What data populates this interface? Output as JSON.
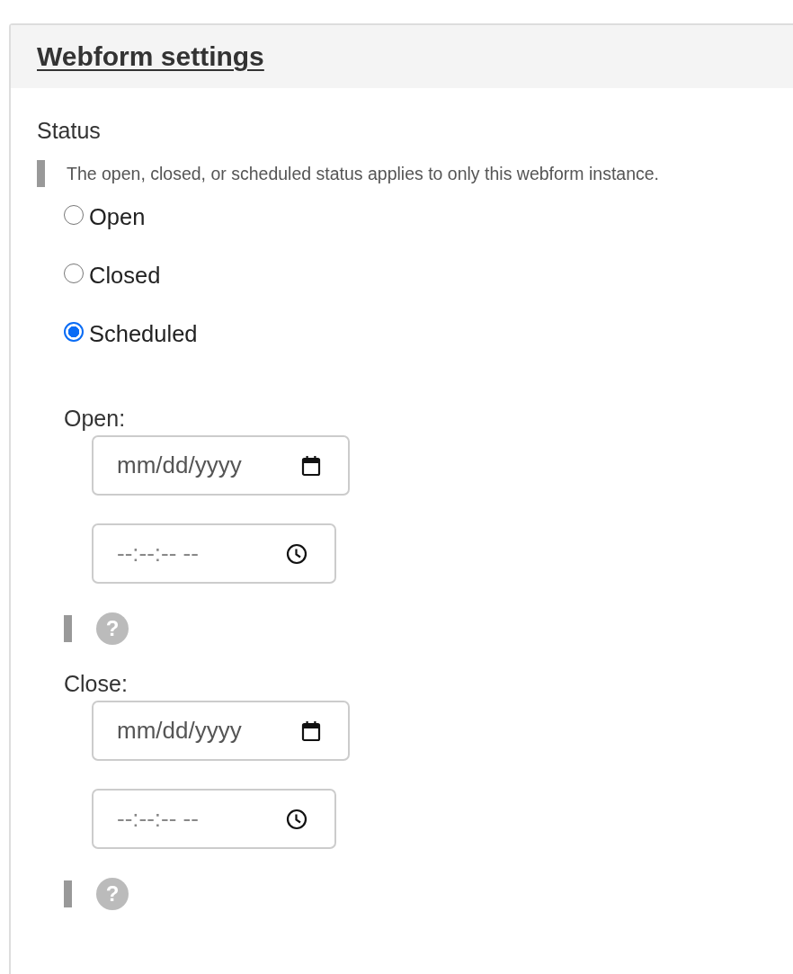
{
  "panel": {
    "title": "Webform settings"
  },
  "status": {
    "label": "Status",
    "description": "The open, closed, or scheduled status applies to only this webform instance.",
    "options": [
      {
        "label": "Open",
        "selected": false
      },
      {
        "label": "Closed",
        "selected": false
      },
      {
        "label": "Scheduled",
        "selected": true
      }
    ]
  },
  "schedule": [
    {
      "label": "Open:",
      "date_placeholder": "mm/dd/yyyy",
      "time_placeholder": "--:--:-- --",
      "help_glyph": "?"
    },
    {
      "label": "Close:",
      "date_placeholder": "mm/dd/yyyy",
      "time_placeholder": "--:--:-- --",
      "help_glyph": "?"
    }
  ]
}
